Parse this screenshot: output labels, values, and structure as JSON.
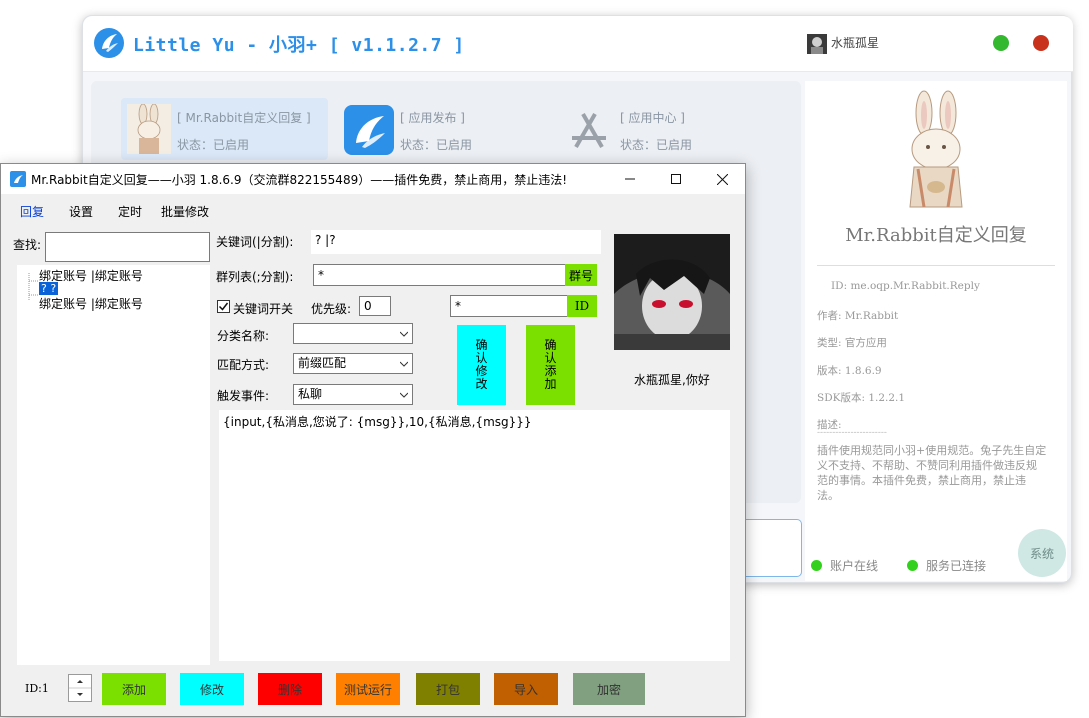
{
  "background_window": {
    "title": "Little Yu - 小羽+ [ v1.1.2.7 ]",
    "user": "水瓶孤星",
    "plugins": [
      {
        "name": "[ Mr.Rabbit自定义回复 ]",
        "status": "状态：已启用",
        "icon": "rabbit-icon"
      },
      {
        "name": "[ 应用发布 ]",
        "status": "状态：已启用",
        "icon": "feather-icon"
      },
      {
        "name": "[ 应用中心 ]",
        "status": "状态：已启用",
        "icon": "app-store-icon"
      }
    ],
    "detail": {
      "name": "Mr.Rabbit自定义回复",
      "id": "ID: me.oqp.Mr.Rabbit.Reply",
      "author": "作者: Mr.Rabbit",
      "type": "类型: 官方应用",
      "version": "版本: 1.8.6.9",
      "sdk": "SDK版本: 1.2.2.1",
      "desc_label": "描述:",
      "desc_divider": "-----------------------",
      "description": "插件使用规范同小羽+使用规范。兔子先生自定义不支持、不帮助、不赞同利用插件做违反规范的事情。本插件免费，禁止商用，禁止违法。"
    },
    "status": {
      "account": "账户在线",
      "service": "服务已连接"
    },
    "system_button": "系统",
    "colors": {
      "accent": "#2c8fe8",
      "online": "#33d11e",
      "minimize": "#33b830",
      "close": "#c8321c"
    }
  },
  "plugin_window": {
    "title": "Mr.Rabbit自定义回复——小羽 1.8.6.9（交流群822155489）——插件免费，禁止商用，禁止违法!",
    "menu": [
      "回复",
      "设置",
      "定时",
      "批量修改"
    ],
    "search_label": "查找:",
    "search_value": "",
    "tree": [
      "绑定账号 |绑定账号",
      "? ?",
      "绑定账号 |绑定账号"
    ],
    "keyword_label": "关键词(|分割):",
    "keyword_value": "? |?",
    "group_label": "群列表(;分割):",
    "group_value": "*",
    "group_button": "群号",
    "keyword_switch_label": "关键词开关",
    "keyword_switch_checked": true,
    "priority_label": "优先级:",
    "priority_value": "0",
    "id_value": "*",
    "id_button": "ID",
    "category_label": "分类名称:",
    "category_value": "",
    "match_label": "匹配方式:",
    "match_value": "前缀匹配",
    "trigger_label": "触发事件:",
    "trigger_value": "私聊",
    "confirm_modify": "确认修改",
    "confirm_add": "确认添加",
    "greeting": "水瓶孤星,你好",
    "reply_content": "{input,{私消息,您说了: {msg}},10,{私消息,{msg}}}",
    "id_label": "ID:1",
    "buttons": [
      {
        "label": "添加",
        "color": "#7be000",
        "text_color": "#000000"
      },
      {
        "label": "修改",
        "color": "#00ffff",
        "text_color": "#000000"
      },
      {
        "label": "删除",
        "color": "#ff0000",
        "text_color": "#000000"
      },
      {
        "label": "测试运行",
        "color": "#ff8000",
        "text_color": "#000000"
      },
      {
        "label": "打包",
        "color": "#808000",
        "text_color": "#000000"
      },
      {
        "label": "导入",
        "color": "#c06000",
        "text_color": "#000000"
      },
      {
        "label": "加密",
        "color": "#80a080",
        "text_color": "#000000"
      }
    ]
  }
}
